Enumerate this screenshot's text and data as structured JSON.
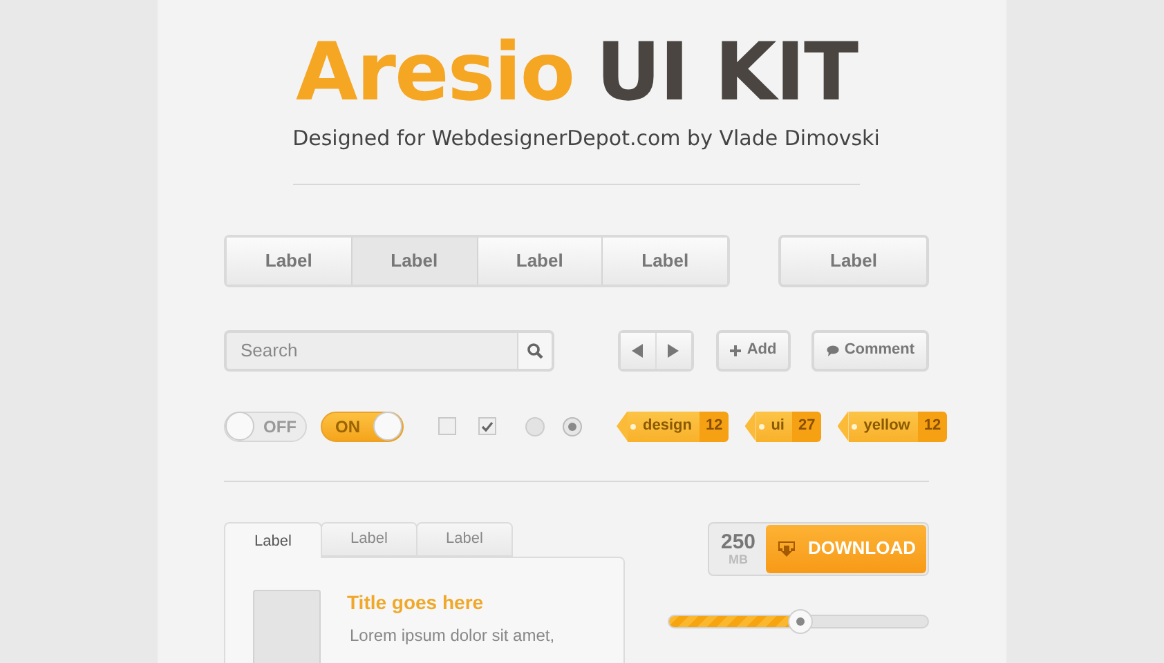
{
  "header": {
    "title_primary": "Aresio",
    "title_secondary": "UI KIT",
    "subtitle": "Designed for WebdesignerDepot.com by Vlade Dimovski"
  },
  "segmented": [
    {
      "label": "Label",
      "selected": false
    },
    {
      "label": "Label",
      "selected": true
    },
    {
      "label": "Label",
      "selected": false
    },
    {
      "label": "Label",
      "selected": false
    }
  ],
  "single_button": {
    "label": "Label"
  },
  "search": {
    "placeholder": "Search"
  },
  "add_button": {
    "label": "Add"
  },
  "comment_button": {
    "label": "Comment"
  },
  "toggles": [
    {
      "label": "OFF",
      "on": false
    },
    {
      "label": "ON",
      "on": true
    }
  ],
  "checkboxes": [
    {
      "checked": false
    },
    {
      "checked": true
    }
  ],
  "radios": [
    {
      "selected": false
    },
    {
      "selected": true
    }
  ],
  "tags": [
    {
      "label": "design",
      "count": "12"
    },
    {
      "label": "ui",
      "count": "27"
    },
    {
      "label": "yellow",
      "count": "12"
    }
  ],
  "tabs": [
    {
      "label": "Label",
      "selected": true
    },
    {
      "label": "Label",
      "selected": false
    },
    {
      "label": "Label",
      "selected": false
    }
  ],
  "card": {
    "title": "Title goes here",
    "text": "Lorem ipsum dolor sit amet,"
  },
  "download": {
    "size": "250",
    "unit": "MB",
    "label": "DOWNLOAD"
  },
  "slider": {
    "level": 0.51
  }
}
